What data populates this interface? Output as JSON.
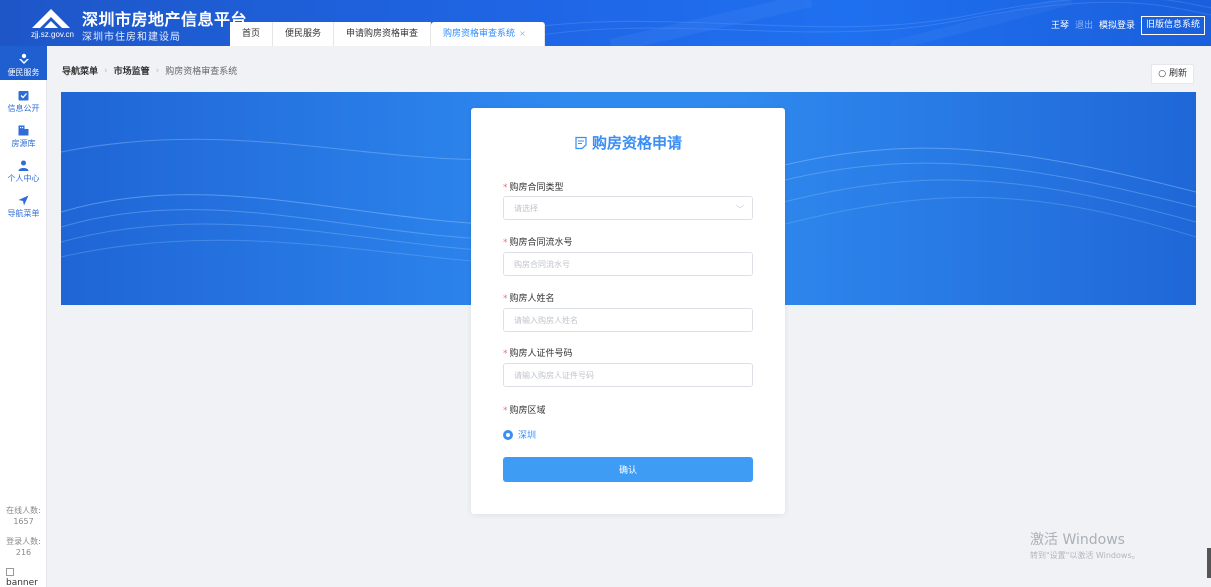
{
  "header": {
    "domain": "zjj.sz.gov.cn",
    "title": "深圳市房地产信息平台",
    "subtitle": "深圳市住房和建设局",
    "tabs": [
      {
        "label": "首页"
      },
      {
        "label": "便民服务"
      },
      {
        "label": "申请购房资格审查"
      },
      {
        "label": "购房资格审查系统",
        "active": true
      }
    ],
    "user": "王琴",
    "logout": "退出",
    "mock_login": "模拟登录",
    "old_system": "旧版信息系统"
  },
  "sidebar": {
    "items": [
      {
        "label": "便民服务",
        "icon": "service-icon"
      },
      {
        "label": "信息公开",
        "icon": "info-icon"
      },
      {
        "label": "房源库",
        "icon": "house-icon"
      },
      {
        "label": "个人中心",
        "icon": "user-icon"
      },
      {
        "label": "导航菜单",
        "icon": "navigation-icon"
      }
    ],
    "online_label": "在线人数:",
    "online_count": "1657",
    "login_label": "登录人数:",
    "login_count": "216",
    "banner_alt": "banner"
  },
  "breadcrumb": {
    "items": [
      "导航菜单",
      "市场监管",
      "购房资格审查系统"
    ]
  },
  "refresh_label": "刷新",
  "form": {
    "title": "购房资格申请",
    "contract_type": {
      "label": "购房合同类型",
      "placeholder": "请选择"
    },
    "contract_no": {
      "label": "购房合同流水号",
      "placeholder": "购房合同流水号"
    },
    "buyer_name": {
      "label": "购房人姓名",
      "placeholder": "请输入购房人姓名"
    },
    "buyer_id": {
      "label": "购房人证件号码",
      "placeholder": "请输入购房人证件号码"
    },
    "region": {
      "label": "购房区域",
      "option": "深圳",
      "selected": true
    },
    "submit": "确认"
  },
  "watermark": {
    "line1": "激活 Windows",
    "line2": "转到\"设置\"以激活 Windows。"
  },
  "colors": {
    "brand": "#1f66e6",
    "accent": "#3a8ef6",
    "required": "#f56c6c"
  }
}
